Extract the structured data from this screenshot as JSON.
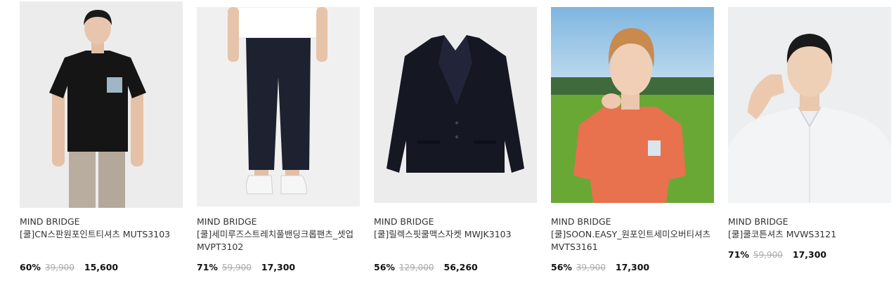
{
  "products": [
    {
      "brand": "MIND BRIDGE",
      "name": "[쿨]CN스판원포인트티셔츠 MUTS3103",
      "discount": "60%",
      "original_price": "39,900",
      "sale_price": "15,600",
      "image": "model in black t-shirt and beige pants"
    },
    {
      "brand": "MIND BRIDGE",
      "name": "[쿨]세미루즈스트레치풀밴딩크롭팬츠_셋업 MVPT3102",
      "discount": "71%",
      "original_price": "59,900",
      "sale_price": "17,300",
      "image": "navy cropped pants with white sneakers"
    },
    {
      "brand": "MIND BRIDGE",
      "name": "[쿨]릴렉스핏쿨맥스자켓 MWJK3103",
      "discount": "56%",
      "original_price": "129,000",
      "sale_price": "56,260",
      "image": "navy blazer jacket"
    },
    {
      "brand": "MIND BRIDGE",
      "name": "[쿨]SOON.EASY_원포인트세미오버티셔츠 MVTS3161",
      "discount": "56%",
      "original_price": "39,900",
      "sale_price": "17,300",
      "image": "model in orange t-shirt on grass field"
    },
    {
      "brand": "MIND BRIDGE",
      "name": "[쿨]쿨코튼셔츠 MVWS3121",
      "discount": "71%",
      "original_price": "59,900",
      "sale_price": "17,300",
      "image": "model in light grey shirt"
    }
  ],
  "colors": {
    "text": "#222222",
    "muted": "#aaaaaa",
    "image_bg": "#eeeeee"
  }
}
